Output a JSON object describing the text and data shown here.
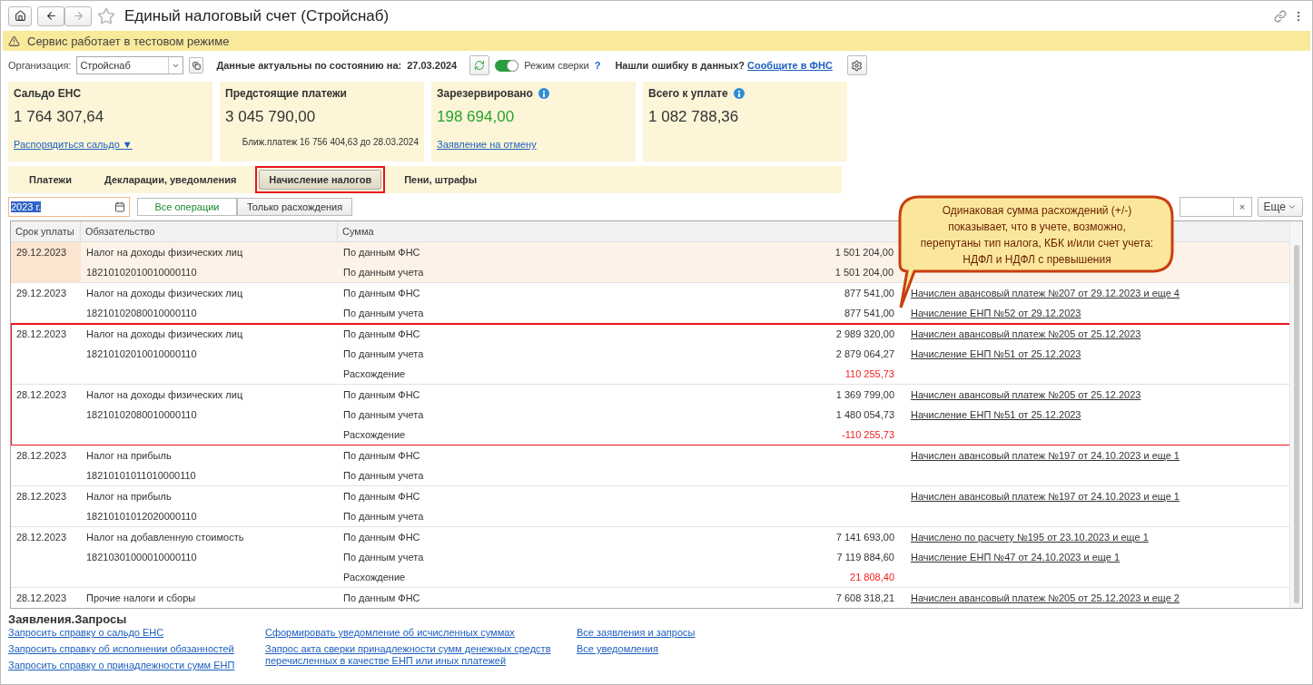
{
  "window": {
    "title": "Единый налоговый счет (Стройснаб)"
  },
  "banner": {
    "text": "Сервис работает в тестовом режиме"
  },
  "org": {
    "label": "Организация:",
    "value": "Стройснаб"
  },
  "actual": {
    "label": "Данные актуальны по состоянию на:",
    "date": "27.03.2024"
  },
  "reconcile": {
    "label": "Режим сверки",
    "on": true,
    "help": "?"
  },
  "report": {
    "label": "Нашли ошибку в данных?",
    "link": "Сообщите в ФНС"
  },
  "cards": [
    {
      "title": "Сальдо ЕНС",
      "amount": "1 764 307,64",
      "info": false,
      "color": "#333333",
      "link": "Распорядиться сальдо ▼"
    },
    {
      "title": "Предстоящие платежи",
      "amount": "3 045 790,00",
      "info": false,
      "color": "#333333",
      "note": "Ближ.платеж 16 756 404,63 до 28.03.2024"
    },
    {
      "title": "Зарезервировано",
      "amount": "198 694,00",
      "info": true,
      "color": "#25a32b",
      "link": "Заявление на отмену"
    },
    {
      "title": "Всего к уплате",
      "amount": "1 082 788,36",
      "info": true,
      "color": "#333333"
    }
  ],
  "tabs": [
    {
      "label": "Платежи",
      "selected": false,
      "highlighted": false
    },
    {
      "label": "Декларации, уведомления",
      "selected": false,
      "highlighted": false
    },
    {
      "label": "Начисление налогов",
      "selected": true,
      "highlighted": true
    },
    {
      "label": "Пени, штрафы",
      "selected": false,
      "highlighted": false
    }
  ],
  "filter": {
    "period": "2023 г.",
    "segments": [
      {
        "label": "Все операции",
        "selected": true
      },
      {
        "label": "Только расхождения",
        "selected": false
      }
    ],
    "clear": "×",
    "more": "Еще"
  },
  "callout": {
    "text": "Одинаковая сумма расхождений (+/-) показывает, что в учете, возможно, перепутаны тип налога, КБК и/или счет учета: НДФЛ и НДФЛ с превышения"
  },
  "table": {
    "columns": [
      "Срок уплаты",
      "Обязательство",
      "Сумма"
    ],
    "rows": [
      {
        "date": "29.12.2023",
        "name": "Налог на доходы физических лиц",
        "kbk": "18210102010010000110",
        "selected": true,
        "highlighted": false,
        "lines": [
          {
            "kind": "fns",
            "label": "По данным ФНС",
            "amount": "1 501 204,00"
          },
          {
            "kind": "account",
            "label": "По данным учета",
            "amount": "1 501 204,00"
          }
        ]
      },
      {
        "date": "29.12.2023",
        "name": "Налог на доходы физических лиц",
        "kbk": "18210102080010000110",
        "selected": false,
        "highlighted": false,
        "lines": [
          {
            "kind": "fns",
            "label": "По данным ФНС",
            "amount": "877 541,00",
            "link": "Начислен авансовый платеж №207 от 29.12.2023 и еще 4"
          },
          {
            "kind": "account",
            "label": "По данным учета",
            "amount": "877 541,00",
            "link": "Начисление ЕНП №52 от 29.12.2023"
          }
        ]
      },
      {
        "date": "28.12.2023",
        "name": "Налог на доходы физических лиц",
        "kbk": "18210102010010000110",
        "selected": false,
        "highlighted": true,
        "lines": [
          {
            "kind": "fns",
            "label": "По данным ФНС",
            "amount": "2 989 320,00",
            "link": "Начислен авансовый платеж №205 от 25.12.2023"
          },
          {
            "kind": "account",
            "label": "По данным учета",
            "amount": "2 879 064,27",
            "link": "Начисление ЕНП №51 от 25.12.2023"
          },
          {
            "kind": "diff",
            "label": "Расхождение",
            "amount": "110 255,73"
          }
        ]
      },
      {
        "date": "28.12.2023",
        "name": "Налог на доходы физических лиц",
        "kbk": "18210102080010000110",
        "selected": false,
        "highlighted": true,
        "lines": [
          {
            "kind": "fns",
            "label": "По данным ФНС",
            "amount": "1 369 799,00",
            "link": "Начислен авансовый платеж №205 от 25.12.2023"
          },
          {
            "kind": "account",
            "label": "По данным учета",
            "amount": "1 480 054,73",
            "link": "Начисление ЕНП №51 от 25.12.2023"
          },
          {
            "kind": "diff",
            "label": "Расхождение",
            "amount": "-110 255,73"
          }
        ]
      },
      {
        "date": "28.12.2023",
        "name": "Налог на прибыль",
        "kbk": "18210101011010000110",
        "selected": false,
        "highlighted": false,
        "lines": [
          {
            "label": "По данным ФНС",
            "link": "Начислен авансовый платеж №197 от 24.10.2023 и еще 1"
          },
          {
            "label": "По данным учета"
          }
        ]
      },
      {
        "date": "28.12.2023",
        "name": "Налог на прибыль",
        "kbk": "18210101012020000110",
        "selected": false,
        "highlighted": false,
        "lines": [
          {
            "label": "По данным ФНС",
            "link": "Начислен авансовый платеж №197 от 24.10.2023 и еще 1"
          },
          {
            "label": "По данным учета"
          }
        ]
      },
      {
        "date": "28.12.2023",
        "name": "Налог на добавленную стоимость",
        "kbk": "18210301000010000110",
        "selected": false,
        "highlighted": false,
        "lines": [
          {
            "kind": "fns",
            "label": "По данным ФНС",
            "amount": "7 141 693,00",
            "link": "Начислено по расчету №195 от 23.10.2023 и еще 1"
          },
          {
            "kind": "account",
            "label": "По данным учета",
            "amount": "7 119 884,60",
            "link": "Начисление ЕНП №47 от 24.10.2023 и еще 1"
          },
          {
            "kind": "diff",
            "label": "Расхождение",
            "amount": "21 808,40"
          }
        ]
      },
      {
        "date": "28.12.2023",
        "name": "Прочие налоги и сборы",
        "selected": false,
        "highlighted": false,
        "lines": [
          {
            "kind": "fns",
            "label": "По данным ФНС",
            "amount": "7 608 318,21",
            "link": "Начислен авансовый платеж №205 от 25.12.2023 и еще 2"
          }
        ]
      }
    ]
  },
  "requests": {
    "title": "Заявления.Запросы",
    "columns": [
      [
        "Запросить справку о сальдо ЕНС",
        "Запросить справку об исполнении обязанностей",
        "Запросить справку о принадлежности сумм ЕНП"
      ],
      [
        "Сформировать уведомление об исчисленных суммах",
        "Запрос акта сверки принадлежности сумм денежных средств перечисленных в качестве ЕНП или иных платежей"
      ],
      [
        "Все заявления и запросы",
        "Все уведомления"
      ]
    ]
  }
}
